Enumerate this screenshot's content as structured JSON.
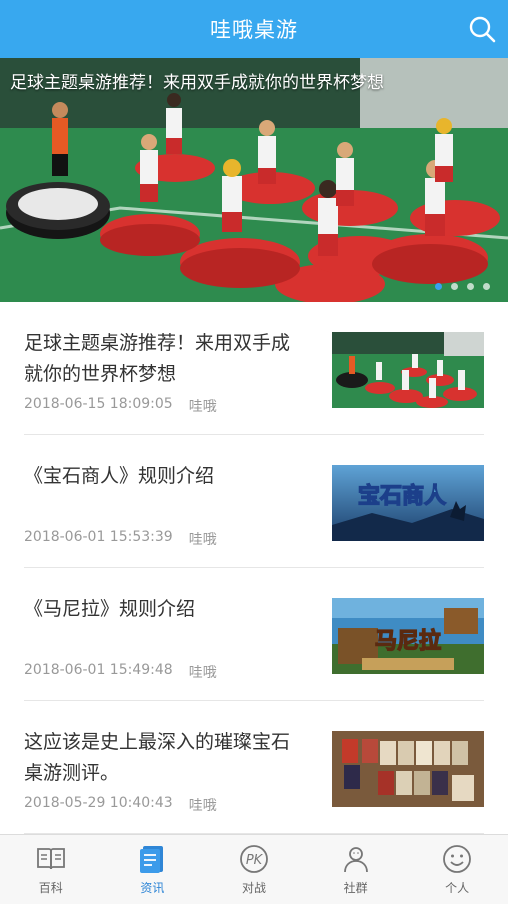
{
  "header": {
    "title": "哇哦桌游",
    "search_icon": "search-icon"
  },
  "banner": {
    "caption": "足球主题桌游推荐！来用双手成就你的世界杯梦想",
    "slide_count": 4,
    "active_slide": 1
  },
  "articles": [
    {
      "title": "足球主题桌游推荐！来用双手成就你的世界杯梦想",
      "date": "2018-06-15 18:09:05",
      "author": "哇哦"
    },
    {
      "title": "《宝石商人》规则介绍",
      "date": "2018-06-01 15:53:39",
      "author": "哇哦",
      "thumb_text": "宝石商人"
    },
    {
      "title": "《马尼拉》规则介绍",
      "date": "2018-06-01 15:49:48",
      "author": "哇哦",
      "thumb_text": "马尼拉"
    },
    {
      "title": "这应该是史上最深入的璀璨宝石桌游测评。",
      "date": "2018-05-29 10:40:43",
      "author": "哇哦"
    }
  ],
  "tabs": [
    {
      "label": "百科",
      "icon": "book-icon",
      "active": false
    },
    {
      "label": "资讯",
      "icon": "news-icon",
      "active": true
    },
    {
      "label": "对战",
      "icon": "pk-icon",
      "active": false
    },
    {
      "label": "社群",
      "icon": "group-icon",
      "active": false
    },
    {
      "label": "个人",
      "icon": "smiley-icon",
      "active": false
    }
  ],
  "colors": {
    "header_bg": "#38a8ef",
    "active_tab": "#2f86d6",
    "inactive_tab": "#666666"
  }
}
